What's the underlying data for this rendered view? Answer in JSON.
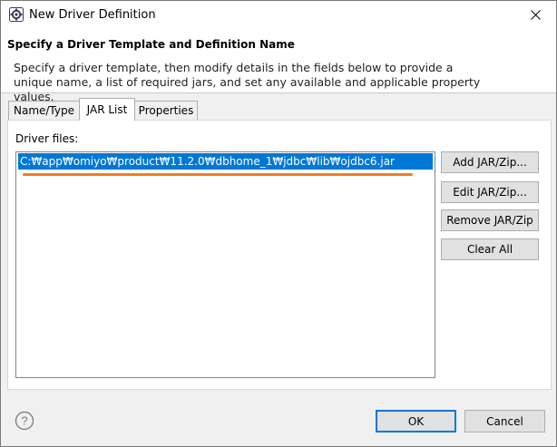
{
  "window": {
    "title": "New Driver Definition",
    "close_symbol": "✕"
  },
  "header": {
    "title": "Specify a Driver Template and Definition Name",
    "description": "Specify a driver template, then modify details in the fields below to provide a unique name, a list of required jars, and set any available and applicable property values."
  },
  "tabs": [
    {
      "label": "Name/Type",
      "active": false
    },
    {
      "label": "JAR List",
      "active": true
    },
    {
      "label": "Properties",
      "active": false
    }
  ],
  "jar_list": {
    "label": "Driver files:",
    "files": [
      "C:₩app₩omiyo₩product₩11.2.0₩dbhome_1₩jdbc₩lib₩ojdbc6.jar"
    ],
    "selected_index": 0,
    "buttons": {
      "add": "Add JAR/Zip...",
      "edit": "Edit JAR/Zip...",
      "remove": "Remove JAR/Zip",
      "clear": "Clear All"
    }
  },
  "footer": {
    "help_symbol": "?",
    "ok": "OK",
    "cancel": "Cancel"
  },
  "colors": {
    "selection": "#0078d7",
    "annotation": "#f07c22",
    "default_button_border": "#0078d7"
  },
  "icons": {
    "title": "eclipse-gear-icon",
    "close": "close-icon",
    "help": "help-icon"
  }
}
